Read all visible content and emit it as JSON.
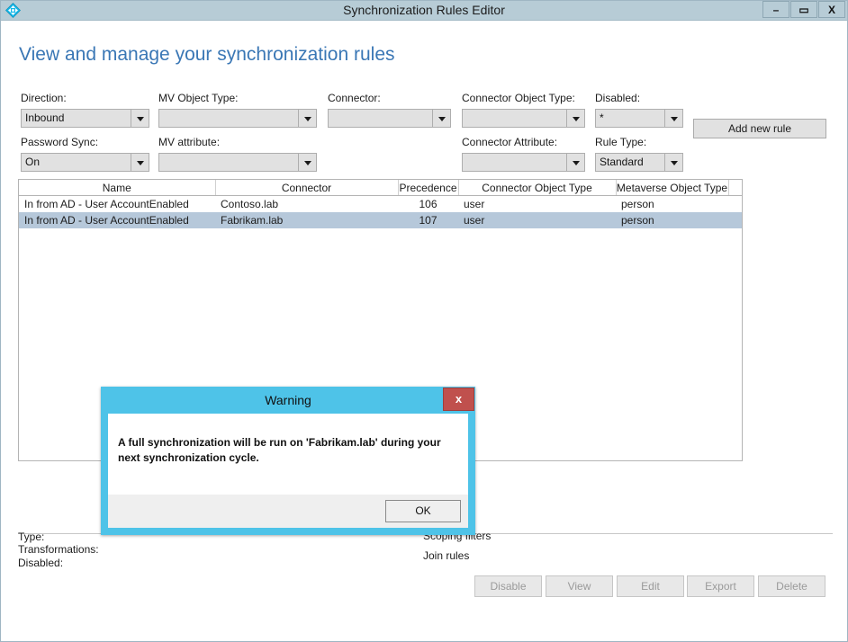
{
  "window": {
    "title": "Synchronization Rules Editor",
    "app_icon": "sync-diamond-icon",
    "controls": {
      "minimize": "–",
      "maximize": "▭",
      "close": "X"
    }
  },
  "page": {
    "heading": "View and manage your synchronization rules"
  },
  "filters": {
    "direction": {
      "label": "Direction:",
      "value": "Inbound"
    },
    "password_sync": {
      "label": "Password Sync:",
      "value": "On"
    },
    "mv_object_type": {
      "label": "MV Object Type:",
      "value": ""
    },
    "mv_attribute": {
      "label": "MV attribute:",
      "value": ""
    },
    "connector": {
      "label": "Connector:",
      "value": ""
    },
    "connector_object_type": {
      "label": "Connector Object Type:",
      "value": ""
    },
    "connector_attribute": {
      "label": "Connector Attribute:",
      "value": ""
    },
    "disabled": {
      "label": "Disabled:",
      "value": "*"
    },
    "rule_type": {
      "label": "Rule Type:",
      "value": "Standard"
    }
  },
  "actions": {
    "add_new_rule": "Add new rule"
  },
  "table": {
    "columns": [
      "Name",
      "Connector",
      "Precedence",
      "Connector Object Type",
      "Metaverse Object Type"
    ],
    "rows": [
      {
        "name": "In from AD - User AccountEnabled",
        "connector": "Contoso.lab",
        "precedence": "106",
        "connector_object_type": "user",
        "metaverse_object_type": "person",
        "selected": false
      },
      {
        "name": "In from AD - User AccountEnabled",
        "connector": "Fabrikam.lab",
        "precedence": "107",
        "connector_object_type": "user",
        "metaverse_object_type": "person",
        "selected": true
      }
    ]
  },
  "details": {
    "type_label": "Type:",
    "transformations_label": "Transformations:",
    "disabled_label": "Disabled:",
    "scoping_filters_label": "Scoping filters",
    "join_rules_label": "Join rules"
  },
  "footer_buttons": [
    {
      "label": "Disable",
      "enabled": false
    },
    {
      "label": "View",
      "enabled": false
    },
    {
      "label": "Edit",
      "enabled": false
    },
    {
      "label": "Export",
      "enabled": false
    },
    {
      "label": "Delete",
      "enabled": false
    }
  ],
  "dialog": {
    "title": "Warning",
    "close_label": "x",
    "message": "A full synchronization will be run on 'Fabrikam.lab' during your next synchronization cycle.",
    "ok_label": "OK"
  },
  "colors": {
    "titlebar": "#b7ccd6",
    "heading": "#3a77b5",
    "dialog_accent": "#4ec3e8",
    "dialog_close": "#c0504d",
    "row_selected": "#b6c8da"
  }
}
